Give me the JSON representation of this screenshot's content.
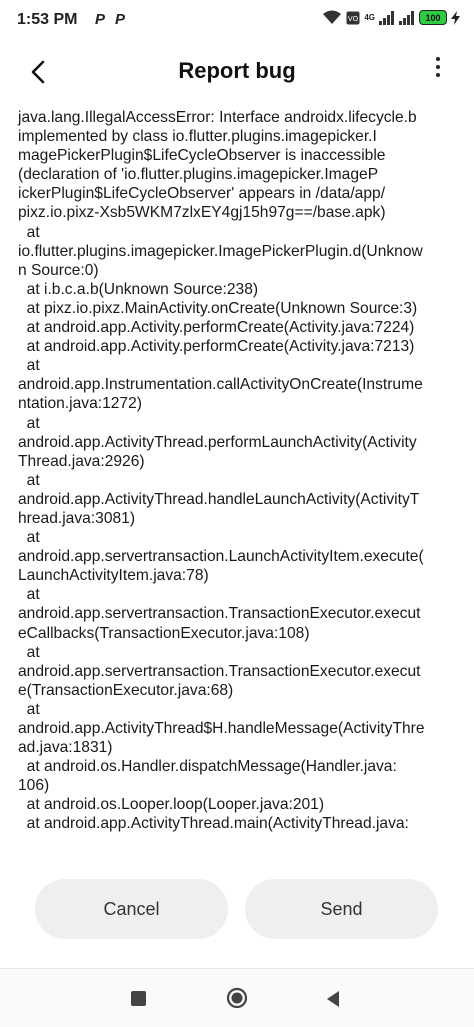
{
  "status_bar": {
    "time": "1:53 PM",
    "notification_icons": [
      "P",
      "P"
    ],
    "network_label": "4G",
    "battery": "100"
  },
  "header": {
    "title": "Report bug"
  },
  "error": {
    "text": "java.lang.IllegalAccessError: Interface androidx.lifecycle.b\nimplemented by class io.flutter.plugins.imagepicker.I\nmagePickerPlugin$LifeCycleObserver is inaccessible\n(declaration of 'io.flutter.plugins.imagepicker.ImageP\nickerPlugin$LifeCycleObserver' appears in /data/app/\npixz.io.pixz-Xsb5WKM7zlxEY4gj15h97g==/base.apk)\n  at\nio.flutter.plugins.imagepicker.ImagePickerPlugin.d(Unknow\nn Source:0)\n  at i.b.c.a.b(Unknown Source:238)\n  at pixz.io.pixz.MainActivity.onCreate(Unknown Source:3)\n  at android.app.Activity.performCreate(Activity.java:7224)\n  at android.app.Activity.performCreate(Activity.java:7213)\n  at\nandroid.app.Instrumentation.callActivityOnCreate(Instrume\nntation.java:1272)\n  at\nandroid.app.ActivityThread.performLaunchActivity(Activity\nThread.java:2926)\n  at\nandroid.app.ActivityThread.handleLaunchActivity(ActivityT\nhread.java:3081)\n  at\nandroid.app.servertransaction.LaunchActivityItem.execute(\nLaunchActivityItem.java:78)\n  at\nandroid.app.servertransaction.TransactionExecutor.execut\neCallbacks(TransactionExecutor.java:108)\n  at\nandroid.app.servertransaction.TransactionExecutor.execut\ne(TransactionExecutor.java:68)\n  at\nandroid.app.ActivityThread$H.handleMessage(ActivityThre\nad.java:1831)\n  at android.os.Handler.dispatchMessage(Handler.java:\n106)\n  at android.os.Looper.loop(Looper.java:201)\n  at android.app.ActivityThread.main(ActivityThread.java:"
  },
  "actions": {
    "cancel_label": "Cancel",
    "send_label": "Send"
  },
  "colors": {
    "battery": "#2ecc40",
    "button_bg": "#efefef"
  },
  "icons": [
    "back-arrow-icon",
    "more-vert-icon",
    "wifi-icon",
    "signal-icon",
    "battery-icon",
    "recents-icon",
    "home-icon",
    "back-triangle-icon"
  ]
}
